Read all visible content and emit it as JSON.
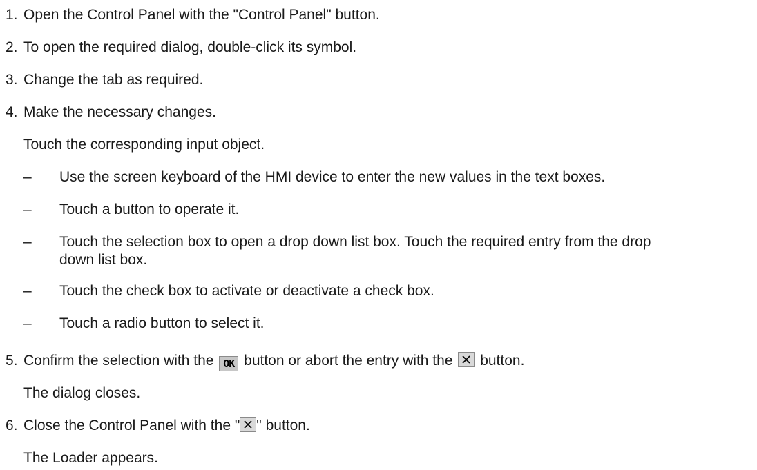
{
  "steps": [
    {
      "num": "1.",
      "text": "Open the Control Panel with the \"Control Panel\" button."
    },
    {
      "num": "2.",
      "text": "To open the required dialog, double-click its symbol."
    },
    {
      "num": "3.",
      "text": "Change the tab as required."
    },
    {
      "num": "4.",
      "text": "Make the necessary changes."
    }
  ],
  "step4_note": "Touch the corresponding input object.",
  "bullets": [
    {
      "dash": "–",
      "text": "Use the screen keyboard of the HMI device to enter the new values in the text boxes."
    },
    {
      "dash": "–",
      "text": "Touch a button to operate it."
    },
    {
      "dash": "–",
      "text": "Touch the selection box to open a drop down list box. Touch the required entry from the drop down list box."
    },
    {
      "dash": "–",
      "text": "Touch the check box to activate or deactivate a check box."
    },
    {
      "dash": "–",
      "text": "Touch a radio button to select it."
    }
  ],
  "step5": {
    "num": "5.",
    "text_a": "Confirm the selection with the",
    "ok_icon_label": "OK",
    "text_b": "button or abort the entry with the",
    "text_c": "button.",
    "note": "The dialog closes."
  },
  "step6": {
    "num": "6.",
    "text_a": "Close the Control Panel with the \"",
    "text_b": "\" button.",
    "note": "The Loader appears."
  },
  "icons": {
    "ok": "ok-button-icon",
    "close": "close-x-button-icon"
  }
}
